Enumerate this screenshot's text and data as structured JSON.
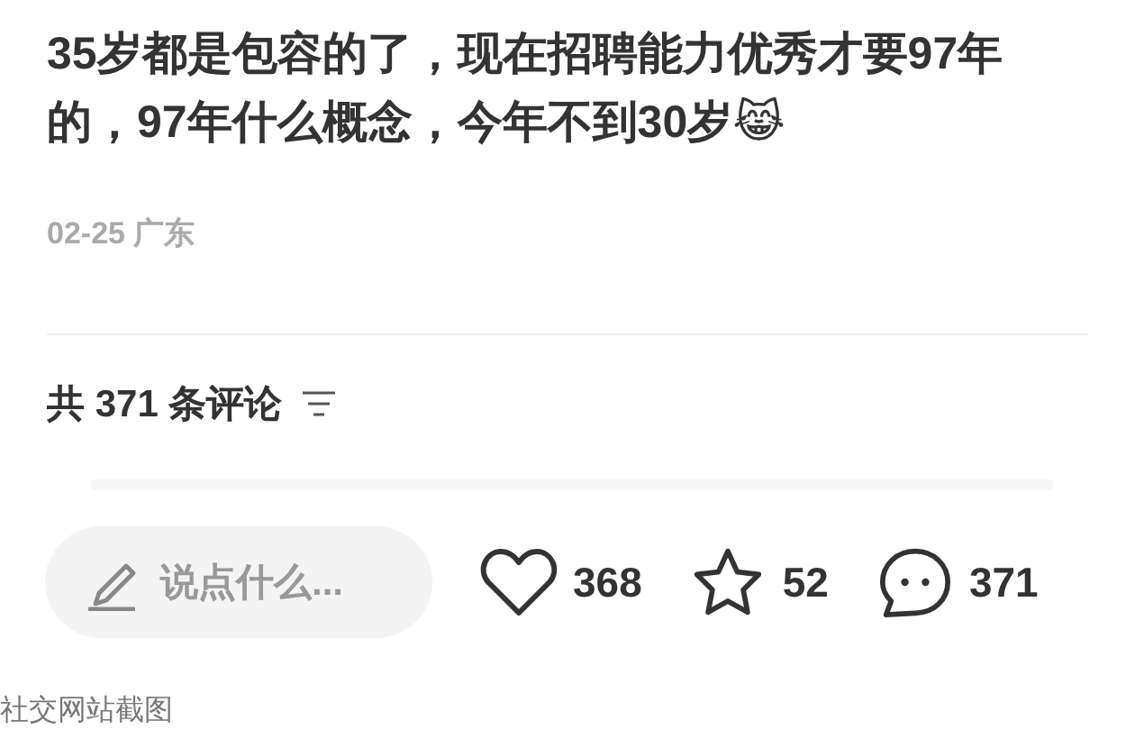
{
  "post": {
    "text": "35岁都是包容的了，现在招聘能力优秀才要97年的，97年什么概念，今年不到30岁😹",
    "meta": "02-25 广东"
  },
  "comments": {
    "header": "共 371 条评论"
  },
  "bottom_bar": {
    "input_placeholder": "说点什么...",
    "likes": "368",
    "favorites": "52",
    "comments": "371"
  },
  "caption": "社交网站截图"
}
